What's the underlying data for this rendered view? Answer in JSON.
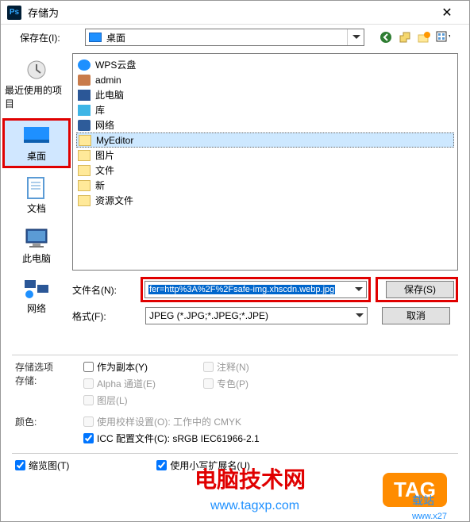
{
  "title": "存储为",
  "close": "✕",
  "location_label": "保存在(I):",
  "location_value": "桌面",
  "places": [
    {
      "label": "最近使用的项目"
    },
    {
      "label": "桌面"
    },
    {
      "label": "文档"
    },
    {
      "label": "此电脑"
    },
    {
      "label": "网络"
    }
  ],
  "files": [
    {
      "name": "WPS云盘",
      "type": "cloud"
    },
    {
      "name": "admin",
      "type": "user"
    },
    {
      "name": "此电脑",
      "type": "pc"
    },
    {
      "name": "库",
      "type": "lib"
    },
    {
      "name": "网络",
      "type": "net"
    },
    {
      "name": "MyEditor",
      "type": "folder",
      "selected": true
    },
    {
      "name": "图片",
      "type": "folder"
    },
    {
      "name": "文件",
      "type": "folder"
    },
    {
      "name": "新",
      "type": "folder"
    },
    {
      "name": "资源文件",
      "type": "folder"
    }
  ],
  "filename_label": "文件名(N):",
  "filename_value": "fer=http%3A%2F%2Fsafe-img.xhscdn.webp.jpg",
  "format_label": "格式(F):",
  "format_value": "JPEG (*.JPG;*.JPEG;*.JPE)",
  "save_btn": "保存(S)",
  "cancel_btn": "取消",
  "options_title": "存储选项",
  "store_label": "存储:",
  "chk_ascopy": "作为副本(Y)",
  "chk_notes": "注释(N)",
  "chk_alpha": "Alpha 通道(E)",
  "chk_spot": "专色(P)",
  "chk_layers": "图层(L)",
  "color_label": "颜色:",
  "chk_proof": "使用校样设置(O): 工作中的 CMYK",
  "chk_icc": "ICC 配置文件(C): sRGB IEC61966-2.1",
  "chk_thumb": "缩览图(T)",
  "chk_lower": "使用小写扩展名(U)",
  "watermark1": "电脑技术网",
  "watermark2": "www.tagxp.com",
  "tag_badge": "TAG",
  "tag_sub": "载站",
  "tag_url": "www.x27"
}
